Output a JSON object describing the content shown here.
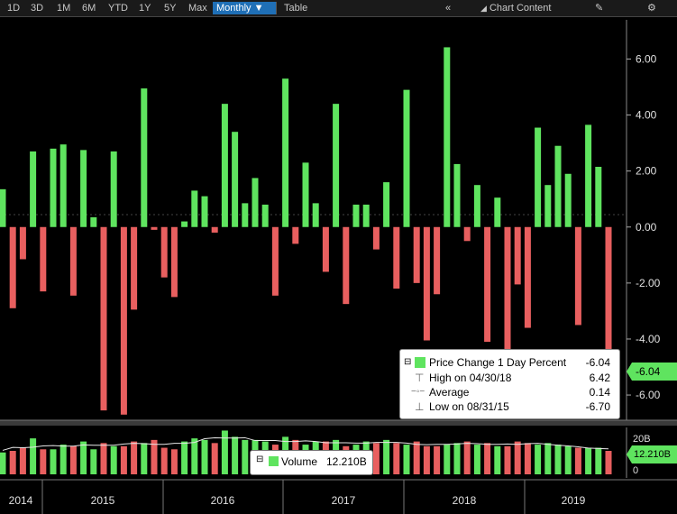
{
  "toolbar": {
    "ranges": [
      "1D",
      "3D",
      "1M",
      "6M",
      "YTD",
      "1Y",
      "5Y",
      "Max"
    ],
    "period": "Monthly",
    "table": "Table",
    "chart_content": "Chart Content"
  },
  "legend": {
    "series_name": "Price Change 1 Day Percent",
    "series_value": "-6.04",
    "high_label": "High on 04/30/18",
    "high_value": "6.42",
    "avg_label": "Average",
    "avg_value": "0.14",
    "low_label": "Low on 08/31/15",
    "low_value": "-6.70"
  },
  "last_value_tag": "-6.04",
  "volume_legend": {
    "label": "Volume",
    "value": "12.210B"
  },
  "volume_tag": "12.210B",
  "volume_axis": [
    "20B",
    "0"
  ],
  "colors": {
    "up": "#5fe45f",
    "down": "#e85f5f",
    "background": "#000000",
    "tag": "#5fe45f"
  },
  "chart_data": {
    "type": "bar",
    "ylim": [
      -6.9,
      7.4
    ],
    "yticks": [
      "6.00",
      "4.00",
      "2.00",
      "0.00",
      "-2.00",
      "-4.00",
      "-6.00"
    ],
    "year_labels": [
      "2014",
      "2015",
      "2016",
      "2017",
      "2018",
      "2019"
    ],
    "series": [
      {
        "name": "Price Change 1 Day Percent",
        "values": [
          1.35,
          -2.9,
          -1.15,
          2.7,
          -2.3,
          2.8,
          2.95,
          -2.45,
          2.75,
          0.35,
          -6.55,
          2.7,
          -6.7,
          -2.95,
          4.95,
          -0.1,
          -1.8,
          -2.5,
          0.2,
          1.3,
          1.1,
          -0.2,
          4.4,
          3.4,
          0.85,
          1.75,
          0.8,
          -2.45,
          5.3,
          -0.6,
          2.3,
          0.85,
          -1.6,
          4.4,
          -2.75,
          0.8,
          0.8,
          -0.8,
          1.6,
          -2.2,
          4.9,
          -2.0,
          -4.05,
          -2.4,
          6.42,
          2.25,
          -0.5,
          1.5,
          -4.1,
          1.05,
          -5.1,
          -2.05,
          -3.6,
          3.55,
          1.5,
          2.9,
          1.9,
          -3.5,
          3.65,
          2.15,
          -6.04
        ]
      },
      {
        "name": "Volume",
        "values": [
          14,
          15,
          17,
          23,
          16,
          16,
          19,
          18,
          21,
          16,
          20,
          18,
          18,
          21,
          20,
          22,
          17,
          16,
          21,
          23,
          22,
          20,
          28,
          24,
          22,
          22,
          21,
          19,
          24,
          22,
          19,
          21,
          21,
          22,
          18,
          19,
          21,
          20,
          22,
          20,
          19,
          21,
          18,
          18,
          19,
          20,
          21,
          19,
          20,
          18,
          18,
          21,
          20,
          19,
          20,
          19,
          18,
          17,
          17,
          17,
          15
        ]
      }
    ],
    "volume_ylim": [
      0,
      30
    ]
  }
}
